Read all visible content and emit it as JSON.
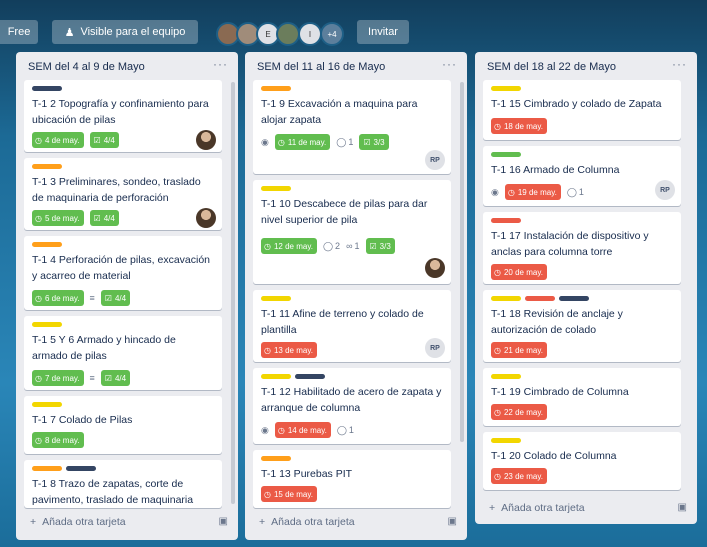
{
  "topbar": {
    "free_label": "Free",
    "visibility_label": "Visible para el equipo",
    "invite_label": "Invitar",
    "members_more": "+4",
    "member_initials": [
      "E",
      "I"
    ]
  },
  "add_card_label": "Añada otra tarjeta",
  "colors": {
    "green": "#61bd4f",
    "red": "#eb5a46",
    "yellow": "#f2d600",
    "orange": "#ff9f1a",
    "navy": "#344563"
  },
  "lists": [
    {
      "title": "SEM del 4 al 9 de Mayo",
      "cards": [
        {
          "title": "T-1 2 Topografía y confinamiento para ubicación de pilas",
          "due": "4 de may.",
          "checklist": "4/4"
        },
        {
          "title": "T-1 3 Preliminares, sondeo, traslado de maquinaria de perforación",
          "due": "5 de may.",
          "checklist": "4/4"
        },
        {
          "title": "T-1 4 Perforación de pilas, excavación y acarreo de material",
          "due": "6 de may.",
          "checklist": "4/4"
        },
        {
          "title": "T-1 5 Y 6 Armado y hincado de armado de pilas",
          "due": "7 de may.",
          "checklist": "4/4"
        },
        {
          "title": "T-1 7 Colado de Pilas",
          "due": "8 de may."
        },
        {
          "title": "T-1 8 Trazo de zapatas, corte de pavimento, traslado de maquinaria"
        }
      ]
    },
    {
      "title": "SEM del 11 al 16 de Mayo",
      "cards": [
        {
          "title": "T-1 9 Excavación a maquina para alojar zapata",
          "due": "11 de may.",
          "comments": "1",
          "checklist": "3/3",
          "member": "RP"
        },
        {
          "title": "T-1 10 Descabece de pilas para dar nivel superior de pila",
          "due": "12 de may.",
          "comments": "2",
          "attachments": "1",
          "checklist": "3/3"
        },
        {
          "title": "T-1 11 Afine de terreno y colado de plantilla",
          "due": "13 de may.",
          "member": "RP"
        },
        {
          "title": "T-1 12 Habilitado de acero de zapata y arranque de columna",
          "due": "14 de may.",
          "comments": "1"
        },
        {
          "title": "T-1 13 Purebas PIT",
          "due": "15 de may."
        }
      ]
    },
    {
      "title": "SEM del 18 al 22 de Mayo",
      "cards": [
        {
          "title": "T-1 15 Cimbrado y colado de Zapata",
          "due": "18 de may."
        },
        {
          "title": "T-1 16 Armado de Columna",
          "due": "19 de may.",
          "comments": "1",
          "member": "RP"
        },
        {
          "title": "T-1 17 Instalación de dispositivo y anclas para columna torre",
          "due": "20 de may."
        },
        {
          "title": "T-1 18 Revisión de anclaje y autorización de colado",
          "due": "21 de may."
        },
        {
          "title": "T-1 19 Cimbrado de Columna",
          "due": "22 de may."
        },
        {
          "title": "T-1 20 Colado de Columna",
          "due": "23 de may."
        }
      ]
    }
  ]
}
